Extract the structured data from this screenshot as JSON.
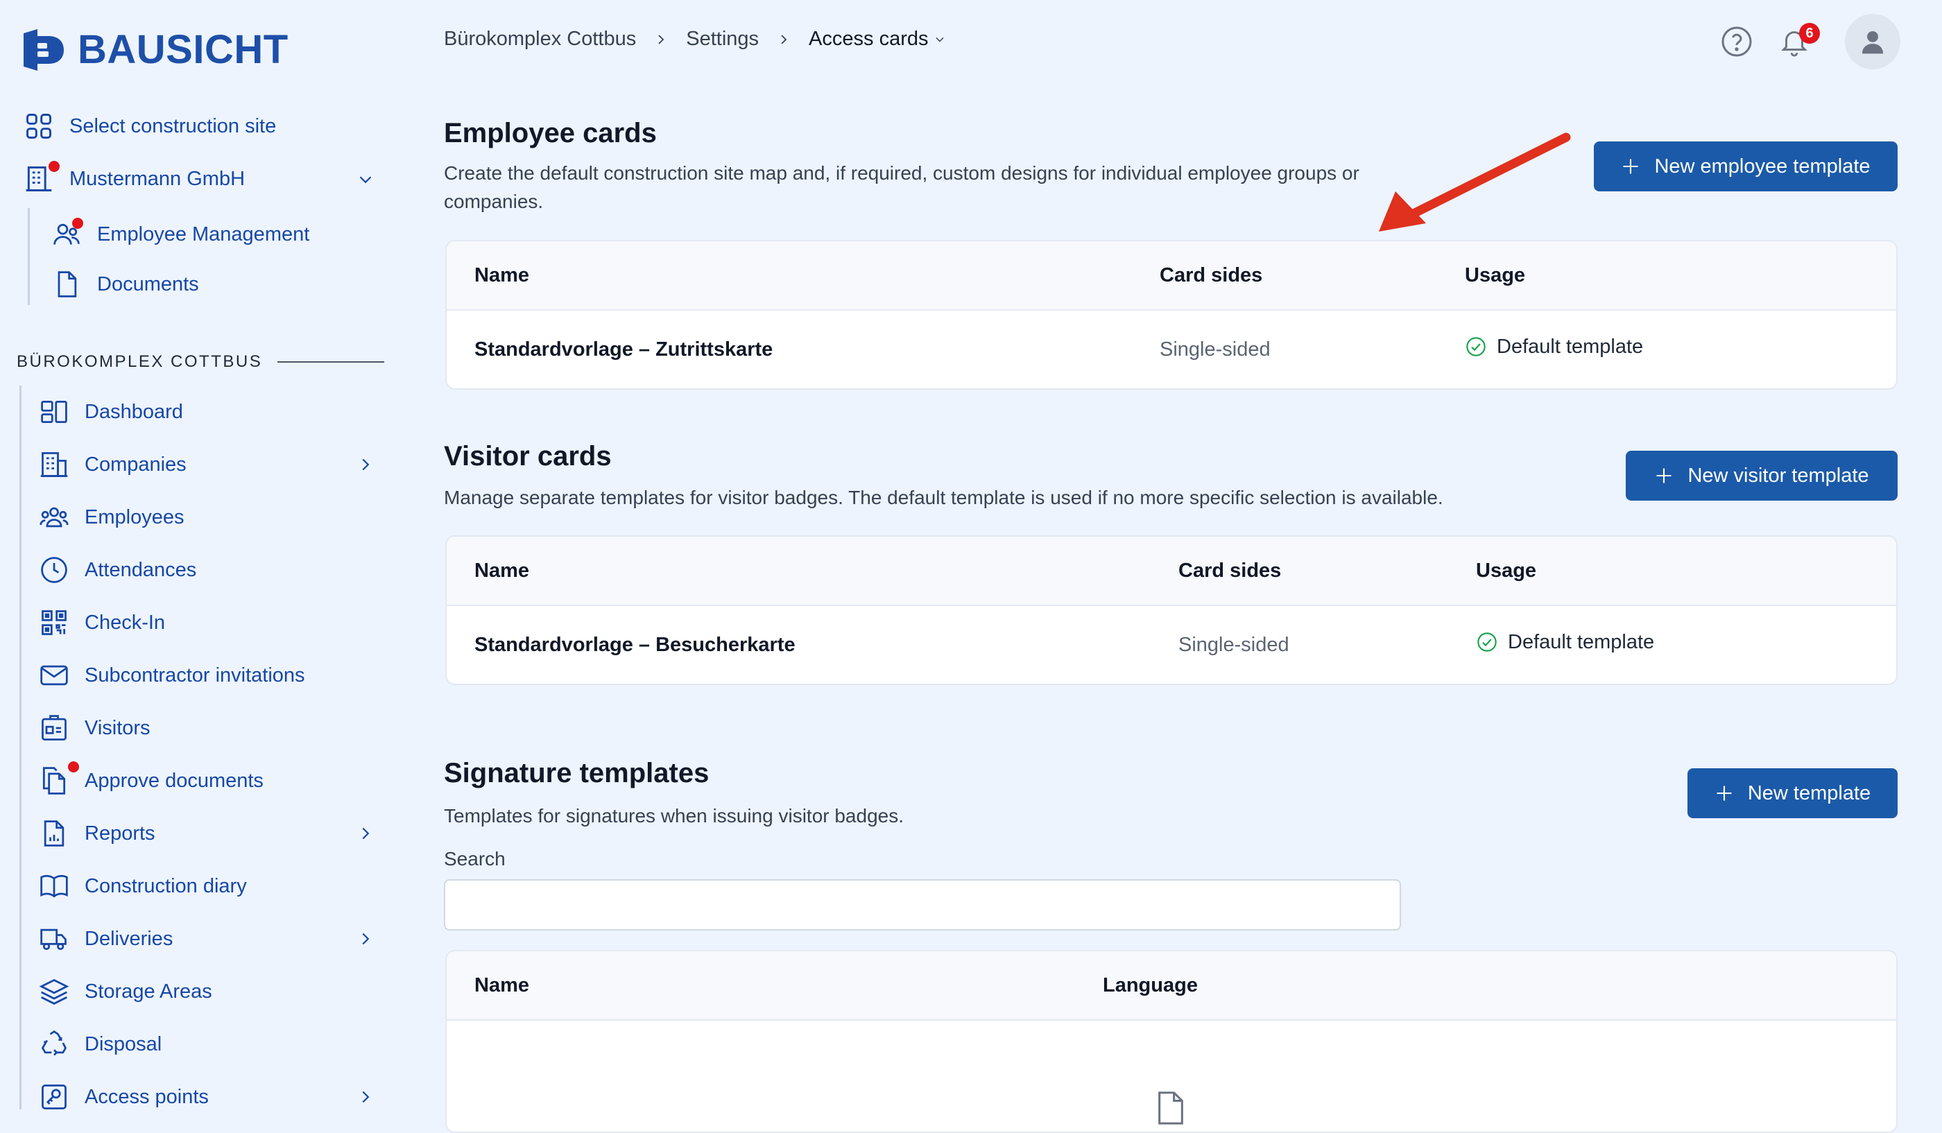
{
  "brand": {
    "name": "BAUSICHT"
  },
  "sidebar": {
    "select_site": "Select construction site",
    "company": "Mustermann GmbH",
    "company_items": [
      {
        "label": "Employee Management"
      },
      {
        "label": "Documents"
      }
    ],
    "section_label": "BÜROKOMPLEX COTTBUS",
    "items": [
      {
        "label": "Dashboard"
      },
      {
        "label": "Companies"
      },
      {
        "label": "Employees"
      },
      {
        "label": "Attendances"
      },
      {
        "label": "Check-In"
      },
      {
        "label": "Subcontractor invitations"
      },
      {
        "label": "Visitors"
      },
      {
        "label": "Approve documents"
      },
      {
        "label": "Reports"
      },
      {
        "label": "Construction diary"
      },
      {
        "label": "Deliveries"
      },
      {
        "label": "Storage Areas"
      },
      {
        "label": "Disposal"
      },
      {
        "label": "Access points"
      }
    ]
  },
  "breadcrumb": {
    "items": [
      "Bürokomplex Cottbus",
      "Settings"
    ],
    "current": "Access cards"
  },
  "header": {
    "notification_count": "6"
  },
  "employee_cards": {
    "title": "Employee cards",
    "description_line1": "Create the default construction site map and, if required, custom designs for individual employee groups or",
    "description_line2": "companies.",
    "button": "New employee template",
    "columns": [
      "Name",
      "Card sides",
      "Usage"
    ],
    "rows": [
      {
        "name": "Standardvorlage – Zutrittskarte",
        "sides": "Single-sided",
        "usage": "Default template"
      }
    ]
  },
  "visitor_cards": {
    "title": "Visitor cards",
    "description": "Manage separate templates for visitor badges. The default template is used if no more specific selection is available.",
    "button": "New visitor template",
    "columns": [
      "Name",
      "Card sides",
      "Usage"
    ],
    "rows": [
      {
        "name": "Standardvorlage – Besucherkarte",
        "sides": "Single-sided",
        "usage": "Default template"
      }
    ]
  },
  "signature_templates": {
    "title": "Signature templates",
    "description": "Templates for signatures when issuing visitor badges.",
    "button": "New template",
    "search_label": "Search",
    "search_value": "",
    "columns": [
      "Name",
      "Language"
    ]
  },
  "colors": {
    "accent": "#1b5aa8",
    "nav_text": "#1747a6",
    "notification": "#e3141c",
    "success": "#16a34a",
    "annotation_arrow": "#e0301e"
  }
}
